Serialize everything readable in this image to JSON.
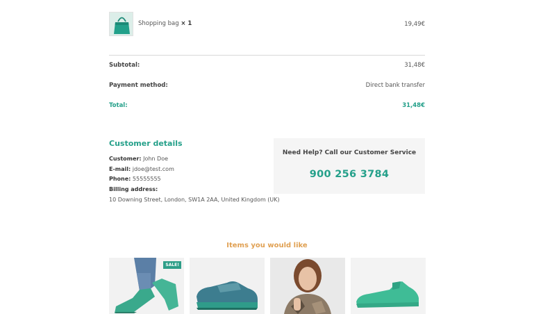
{
  "order": {
    "item": {
      "name": "Shopping bag",
      "qty": "× 1",
      "price": "19,49€"
    }
  },
  "totals": {
    "subtotal_label": "Subtotal:",
    "subtotal_value": "31,48€",
    "payment_label": "Payment method:",
    "payment_value": "Direct bank transfer",
    "total_label": "Total:",
    "total_value": "31,48€"
  },
  "customer": {
    "title": "Customer details",
    "customer_label": "Customer:",
    "customer_value": "John Doe",
    "email_label": "E-mail:",
    "email_value": "jdoe@test.com",
    "phone_label": "Phone:",
    "phone_value": "55555555",
    "billing_label": "Billing address:",
    "billing_value": "10 Downing Street, London, SW1A 2AA, United Kingdom (UK)"
  },
  "help": {
    "title": "Need Help? Call our Customer Service",
    "phone": "900 256 3784"
  },
  "recommendations": {
    "title": "Items you would like",
    "sale_badge": "SALE!"
  },
  "colors": {
    "accent": "#25a08a",
    "orange": "#e0a052",
    "panel": "#f5f5f5"
  }
}
